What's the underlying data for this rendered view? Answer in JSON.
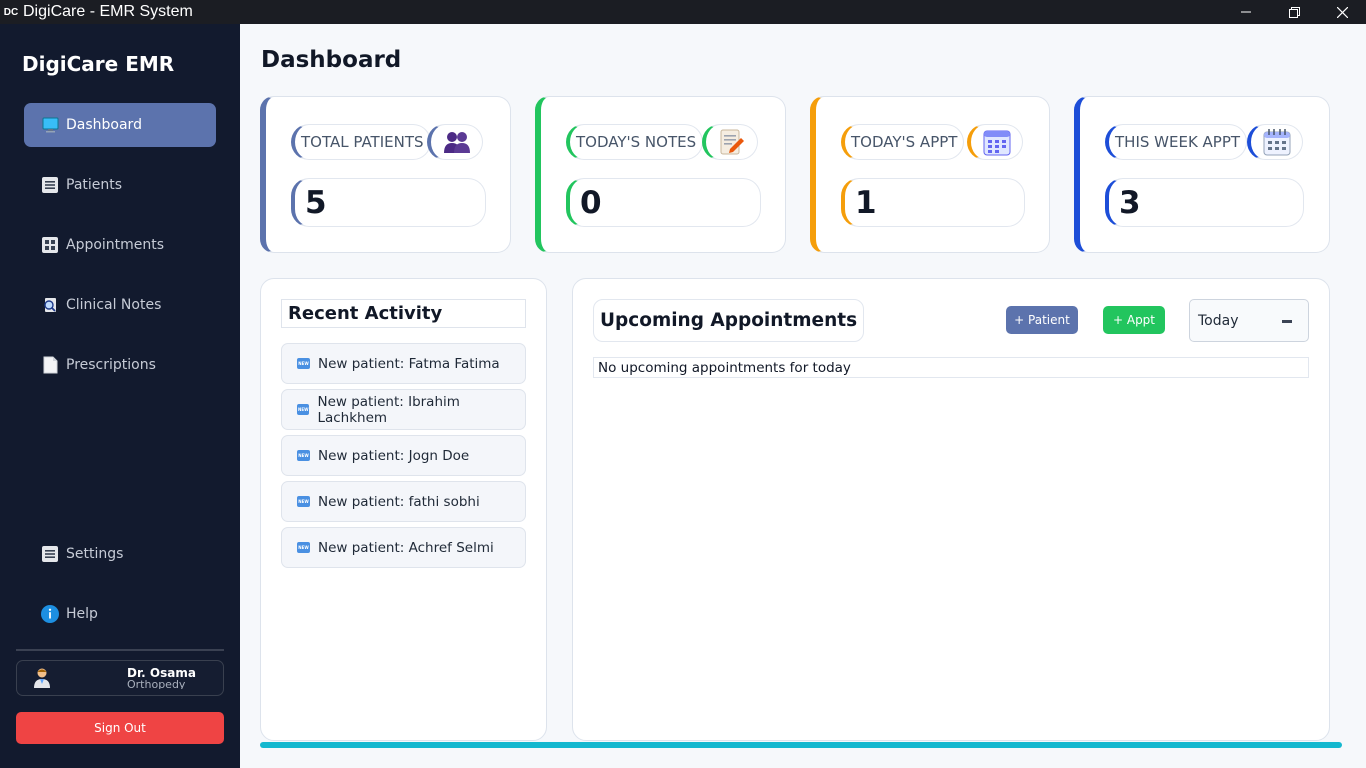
{
  "window": {
    "logo_text": "DC",
    "title": "DigiCare - EMR System"
  },
  "sidebar": {
    "brand": "DigiCare EMR",
    "items": [
      {
        "label": "Dashboard",
        "icon": "monitor-icon"
      },
      {
        "label": "Patients",
        "icon": "list-icon"
      },
      {
        "label": "Appointments",
        "icon": "grid-icon"
      },
      {
        "label": "Clinical Notes",
        "icon": "search-document-icon"
      },
      {
        "label": "Prescriptions",
        "icon": "document-icon"
      }
    ],
    "settings_label": "Settings",
    "help_label": "Help",
    "user": {
      "name": "Dr. Osama",
      "specialty": "Orthopedy"
    },
    "signout_label": "Sign Out"
  },
  "page": {
    "title": "Dashboard"
  },
  "stats": [
    {
      "label": "TOTAL PATIENTS",
      "value": "5",
      "icon": "users-icon",
      "color": "#5c73ad"
    },
    {
      "label": "TODAY'S NOTES",
      "value": "0",
      "icon": "notepad-icon",
      "color": "#22c55e"
    },
    {
      "label": "TODAY'S APPT",
      "value": "1",
      "icon": "calendar-icon",
      "color": "#f59e0b"
    },
    {
      "label": "THIS WEEK APPT",
      "value": "3",
      "icon": "spiral-calendar-icon",
      "color": "#1d4ed8"
    }
  ],
  "recent_activity": {
    "title": "Recent Activity",
    "items": [
      "New patient: Fatma Fatima",
      "New patient: Ibrahim Lachkhem",
      "New patient: Jogn Doe",
      "New patient: fathi sobhi",
      "New patient: Achref Selmi"
    ],
    "item_icon": "new-badge-icon",
    "item_icon_text": "NEW"
  },
  "upcoming": {
    "title": "Upcoming Appointments",
    "add_patient_label": "+ Patient",
    "add_appt_label": "+ Appt",
    "filter_value": "Today",
    "empty_message": "No upcoming appointments for today"
  },
  "colors": {
    "sidebar_bg": "#121a2e",
    "accent": "#5c73ad",
    "success": "#22c55e",
    "danger": "#ef4444",
    "progress": "#14b8cf"
  }
}
